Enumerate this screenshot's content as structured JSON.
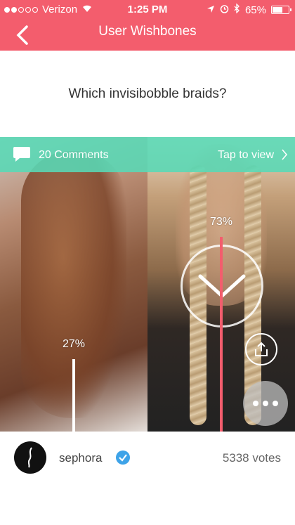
{
  "status": {
    "carrier": "Verizon",
    "time": "1:25 PM",
    "battery": "65%",
    "battery_level": 0.65,
    "signal_bars": 2
  },
  "nav": {
    "title": "User Wishbones"
  },
  "question": "Which invisibobble braids?",
  "comments": {
    "count_label": "20 Comments",
    "tap_label": "Tap to view"
  },
  "poll": {
    "left_percent": "27%",
    "right_percent": "73%",
    "left_value": 0.27,
    "right_value": 0.73
  },
  "footer": {
    "username": "sephora",
    "votes": "5338 votes"
  },
  "colors": {
    "brand": "#f35d6d",
    "comments_bar": "#58d9b6",
    "verified": "#3ea3e8"
  }
}
